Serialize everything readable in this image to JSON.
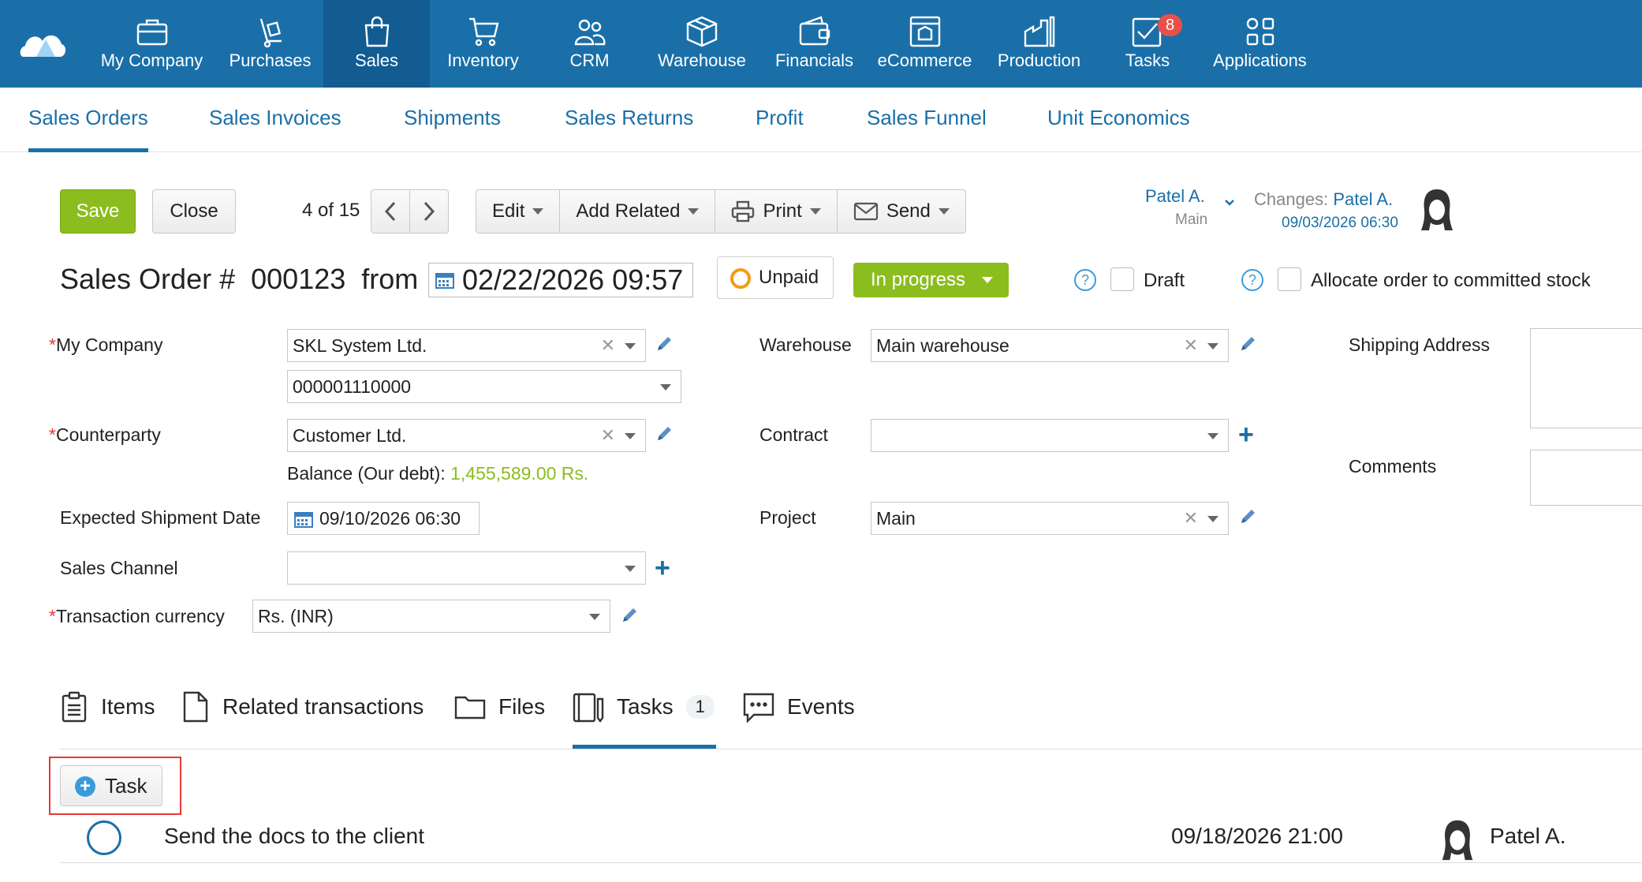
{
  "nav": {
    "items": [
      {
        "label": "My Company",
        "icon": "briefcase-icon"
      },
      {
        "label": "Purchases",
        "icon": "hand-truck-icon"
      },
      {
        "label": "Sales",
        "icon": "shopping-bag-icon"
      },
      {
        "label": "Inventory",
        "icon": "cart-icon"
      },
      {
        "label": "CRM",
        "icon": "people-icon"
      },
      {
        "label": "Warehouse",
        "icon": "box-icon"
      },
      {
        "label": "Financials",
        "icon": "wallet-icon"
      },
      {
        "label": "eCommerce",
        "icon": "store-icon"
      },
      {
        "label": "Production",
        "icon": "factory-icon"
      },
      {
        "label": "Tasks",
        "icon": "checkbox-envelope-icon",
        "badge": "8"
      },
      {
        "label": "Applications",
        "icon": "apps-grid-icon"
      }
    ],
    "active": "Sales"
  },
  "subnav": {
    "tabs": [
      "Sales Orders",
      "Sales Invoices",
      "Shipments",
      "Sales Returns",
      "Profit",
      "Sales Funnel",
      "Unit Economics"
    ],
    "active": "Sales Orders"
  },
  "toolbar": {
    "save_label": "Save",
    "close_label": "Close",
    "pager": "4 of 15",
    "edit_label": "Edit",
    "add_related_label": "Add Related",
    "print_label": "Print",
    "send_label": "Send",
    "owner": "Patel A.",
    "owner_sub": "Main",
    "changes_label": "Changes:",
    "changes_user": "Patel A.",
    "changes_date": "09/03/2026 06:30"
  },
  "order": {
    "title_prefix": "Sales Order #",
    "number": "000123",
    "from_label": "from",
    "date": "02/22/2026 09:57",
    "payment_status": "Unpaid",
    "status": "In progress",
    "draft_label": "Draft",
    "allocate_label": "Allocate order to committed stock",
    "help_glyph": "?"
  },
  "form": {
    "my_company_label": "My Company",
    "my_company": "SKL System Ltd.",
    "account": "000001110000",
    "counterparty_label": "Counterparty",
    "counterparty": "Customer Ltd.",
    "balance_label": "Balance (Our debt):",
    "balance_value": "1,455,589.00 Rs.",
    "shipment_date_label": "Expected Shipment Date",
    "shipment_date": "09/10/2026 06:30",
    "sales_channel_label": "Sales Channel",
    "sales_channel": "",
    "currency_label": "Transaction currency",
    "currency": "Rs. (INR)",
    "warehouse_label": "Warehouse",
    "warehouse": "Main warehouse",
    "contract_label": "Contract",
    "contract": "",
    "project_label": "Project",
    "project": "Main",
    "shipping_address_label": "Shipping Address",
    "comments_label": "Comments",
    "required_mark": "*"
  },
  "doc_tabs": {
    "items": [
      {
        "label": "Items",
        "icon": "clipboard-icon"
      },
      {
        "label": "Related transactions",
        "icon": "document-icon"
      },
      {
        "label": "Files",
        "icon": "folder-icon"
      },
      {
        "label": "Tasks",
        "icon": "notebook-icon",
        "count": "1"
      },
      {
        "label": "Events",
        "icon": "chat-icon"
      }
    ],
    "active": "Tasks"
  },
  "tasks": {
    "add_label": "Task",
    "rows": [
      {
        "title": "Send the docs to the client",
        "due": "09/18/2026 21:00",
        "assignee": "Patel A."
      }
    ]
  },
  "colors": {
    "nav_bg": "#1a6fa8",
    "accent_green": "#8bbd1f",
    "link_blue": "#1a6fa8",
    "badge_red": "#e8514a",
    "unpaid_orange": "#f39c12"
  }
}
